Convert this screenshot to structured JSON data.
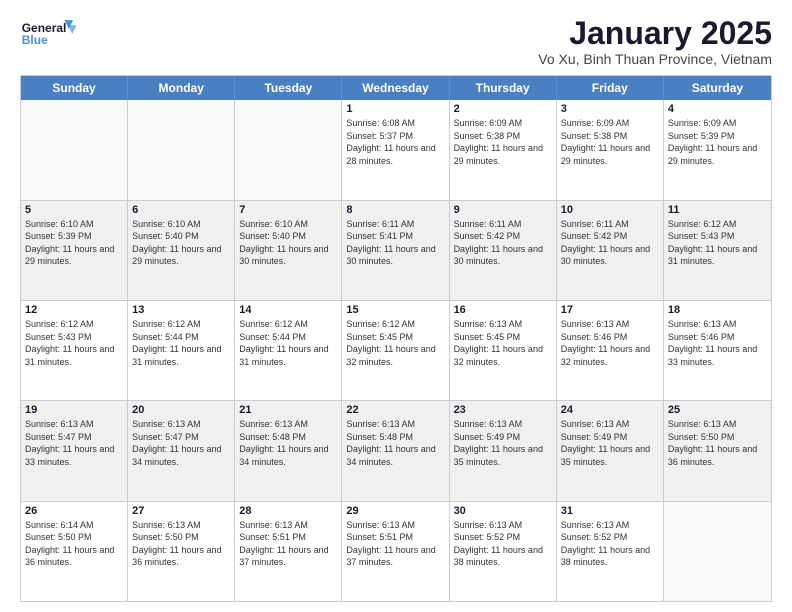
{
  "header": {
    "logo_line1": "General",
    "logo_line2": "Blue",
    "month_title": "January 2025",
    "subtitle": "Vo Xu, Binh Thuan Province, Vietnam"
  },
  "weekdays": [
    "Sunday",
    "Monday",
    "Tuesday",
    "Wednesday",
    "Thursday",
    "Friday",
    "Saturday"
  ],
  "rows": [
    [
      {
        "day": "",
        "text": "",
        "empty": true
      },
      {
        "day": "",
        "text": "",
        "empty": true
      },
      {
        "day": "",
        "text": "",
        "empty": true
      },
      {
        "day": "1",
        "text": "Sunrise: 6:08 AM\nSunset: 5:37 PM\nDaylight: 11 hours and 28 minutes.",
        "empty": false
      },
      {
        "day": "2",
        "text": "Sunrise: 6:09 AM\nSunset: 5:38 PM\nDaylight: 11 hours and 29 minutes.",
        "empty": false
      },
      {
        "day": "3",
        "text": "Sunrise: 6:09 AM\nSunset: 5:38 PM\nDaylight: 11 hours and 29 minutes.",
        "empty": false
      },
      {
        "day": "4",
        "text": "Sunrise: 6:09 AM\nSunset: 5:39 PM\nDaylight: 11 hours and 29 minutes.",
        "empty": false
      }
    ],
    [
      {
        "day": "5",
        "text": "Sunrise: 6:10 AM\nSunset: 5:39 PM\nDaylight: 11 hours and 29 minutes.",
        "empty": false
      },
      {
        "day": "6",
        "text": "Sunrise: 6:10 AM\nSunset: 5:40 PM\nDaylight: 11 hours and 29 minutes.",
        "empty": false
      },
      {
        "day": "7",
        "text": "Sunrise: 6:10 AM\nSunset: 5:40 PM\nDaylight: 11 hours and 30 minutes.",
        "empty": false
      },
      {
        "day": "8",
        "text": "Sunrise: 6:11 AM\nSunset: 5:41 PM\nDaylight: 11 hours and 30 minutes.",
        "empty": false
      },
      {
        "day": "9",
        "text": "Sunrise: 6:11 AM\nSunset: 5:42 PM\nDaylight: 11 hours and 30 minutes.",
        "empty": false
      },
      {
        "day": "10",
        "text": "Sunrise: 6:11 AM\nSunset: 5:42 PM\nDaylight: 11 hours and 30 minutes.",
        "empty": false
      },
      {
        "day": "11",
        "text": "Sunrise: 6:12 AM\nSunset: 5:43 PM\nDaylight: 11 hours and 31 minutes.",
        "empty": false
      }
    ],
    [
      {
        "day": "12",
        "text": "Sunrise: 6:12 AM\nSunset: 5:43 PM\nDaylight: 11 hours and 31 minutes.",
        "empty": false
      },
      {
        "day": "13",
        "text": "Sunrise: 6:12 AM\nSunset: 5:44 PM\nDaylight: 11 hours and 31 minutes.",
        "empty": false
      },
      {
        "day": "14",
        "text": "Sunrise: 6:12 AM\nSunset: 5:44 PM\nDaylight: 11 hours and 31 minutes.",
        "empty": false
      },
      {
        "day": "15",
        "text": "Sunrise: 6:12 AM\nSunset: 5:45 PM\nDaylight: 11 hours and 32 minutes.",
        "empty": false
      },
      {
        "day": "16",
        "text": "Sunrise: 6:13 AM\nSunset: 5:45 PM\nDaylight: 11 hours and 32 minutes.",
        "empty": false
      },
      {
        "day": "17",
        "text": "Sunrise: 6:13 AM\nSunset: 5:46 PM\nDaylight: 11 hours and 32 minutes.",
        "empty": false
      },
      {
        "day": "18",
        "text": "Sunrise: 6:13 AM\nSunset: 5:46 PM\nDaylight: 11 hours and 33 minutes.",
        "empty": false
      }
    ],
    [
      {
        "day": "19",
        "text": "Sunrise: 6:13 AM\nSunset: 5:47 PM\nDaylight: 11 hours and 33 minutes.",
        "empty": false
      },
      {
        "day": "20",
        "text": "Sunrise: 6:13 AM\nSunset: 5:47 PM\nDaylight: 11 hours and 34 minutes.",
        "empty": false
      },
      {
        "day": "21",
        "text": "Sunrise: 6:13 AM\nSunset: 5:48 PM\nDaylight: 11 hours and 34 minutes.",
        "empty": false
      },
      {
        "day": "22",
        "text": "Sunrise: 6:13 AM\nSunset: 5:48 PM\nDaylight: 11 hours and 34 minutes.",
        "empty": false
      },
      {
        "day": "23",
        "text": "Sunrise: 6:13 AM\nSunset: 5:49 PM\nDaylight: 11 hours and 35 minutes.",
        "empty": false
      },
      {
        "day": "24",
        "text": "Sunrise: 6:13 AM\nSunset: 5:49 PM\nDaylight: 11 hours and 35 minutes.",
        "empty": false
      },
      {
        "day": "25",
        "text": "Sunrise: 6:13 AM\nSunset: 5:50 PM\nDaylight: 11 hours and 36 minutes.",
        "empty": false
      }
    ],
    [
      {
        "day": "26",
        "text": "Sunrise: 6:14 AM\nSunset: 5:50 PM\nDaylight: 11 hours and 36 minutes.",
        "empty": false
      },
      {
        "day": "27",
        "text": "Sunrise: 6:13 AM\nSunset: 5:50 PM\nDaylight: 11 hours and 36 minutes.",
        "empty": false
      },
      {
        "day": "28",
        "text": "Sunrise: 6:13 AM\nSunset: 5:51 PM\nDaylight: 11 hours and 37 minutes.",
        "empty": false
      },
      {
        "day": "29",
        "text": "Sunrise: 6:13 AM\nSunset: 5:51 PM\nDaylight: 11 hours and 37 minutes.",
        "empty": false
      },
      {
        "day": "30",
        "text": "Sunrise: 6:13 AM\nSunset: 5:52 PM\nDaylight: 11 hours and 38 minutes.",
        "empty": false
      },
      {
        "day": "31",
        "text": "Sunrise: 6:13 AM\nSunset: 5:52 PM\nDaylight: 11 hours and 38 minutes.",
        "empty": false
      },
      {
        "day": "",
        "text": "",
        "empty": true
      }
    ]
  ]
}
